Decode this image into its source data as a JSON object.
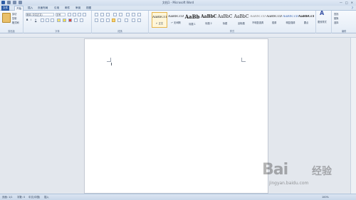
{
  "window": {
    "title": "文档1 - Microsoft Word",
    "min": "—",
    "max": "□",
    "close": "✕"
  },
  "tabs": [
    {
      "label": "文件"
    },
    {
      "label": "开始"
    },
    {
      "label": "插入"
    },
    {
      "label": "页面布局"
    },
    {
      "label": "引用"
    },
    {
      "label": "邮件"
    },
    {
      "label": "审阅"
    },
    {
      "label": "视图"
    }
  ],
  "clipboard": {
    "cut": "剪切",
    "copy": "复制",
    "format_painter": "格式刷",
    "group": "剪贴板"
  },
  "font": {
    "name": "宋体 (中文正文)",
    "size": "五号",
    "group": "字体"
  },
  "paragraph": {
    "group": "段落"
  },
  "styles": {
    "group": "样式",
    "items": [
      {
        "sample": "AaBbCcDd",
        "name": "↵ 正文"
      },
      {
        "sample": "AaBbCcDd",
        "name": "↵ 无间隔"
      },
      {
        "sample": "AaBb",
        "name": "标题 1"
      },
      {
        "sample": "AaBbC",
        "name": "标题 2"
      },
      {
        "sample": "AaBbC",
        "name": "标题"
      },
      {
        "sample": "AaBbC",
        "name": "副标题"
      },
      {
        "sample": "AaBbCcDd",
        "name": "不明显强调"
      },
      {
        "sample": "AaBbCcDd",
        "name": "强调"
      },
      {
        "sample": "AaBbCcDc",
        "name": "明显强调"
      },
      {
        "sample": "AaBbCcDc",
        "name": "要点"
      }
    ],
    "change_styles": "更改样式"
  },
  "editing": {
    "find": "查找",
    "replace": "替换",
    "select": "选择",
    "group": "编辑"
  },
  "status": {
    "page": "页面: 1/1",
    "words": "字数: 0",
    "language": "中文(中国)",
    "mode": "插入",
    "zoom": "100%"
  },
  "watermark": {
    "logo": "Bai",
    "cn": "经验",
    "url": "jingyan.baidu.com"
  },
  "colors": {
    "file_tab": "#2a5ba6",
    "ribbon": "#e4ecf6",
    "workspace": "#e3e7ed"
  }
}
